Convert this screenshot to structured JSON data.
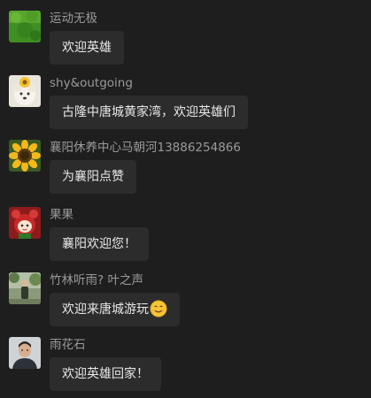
{
  "messages": [
    {
      "name": "运动无极",
      "text": "欢迎英雄",
      "avatar": "grass-avatar-icon"
    },
    {
      "name": "shy&outgoing",
      "text": "古隆中唐城黄家湾，欢迎英雄们",
      "avatar": "dog-avatar-icon"
    },
    {
      "name": "襄阳休养中心马朝河13886254866",
      "text": "为襄阳点赞",
      "avatar": "sunflower-avatar-icon"
    },
    {
      "name": "果果",
      "text": "襄阳欢迎您！",
      "avatar": "cartoon-girl-avatar-icon"
    },
    {
      "name": "竹林听雨? 叶之声",
      "text": "欢迎来唐城游玩",
      "avatar": "person-outdoor-avatar-icon",
      "emoji": "smile-emoji-icon"
    },
    {
      "name": "雨花石",
      "text": "欢迎英雄回家！",
      "avatar": "man-portrait-avatar-icon"
    }
  ],
  "colors": {
    "background": "#1e1e1f",
    "bubble": "#2c2c2c",
    "name": "#9a9a9a",
    "text": "#e8e8e8"
  }
}
